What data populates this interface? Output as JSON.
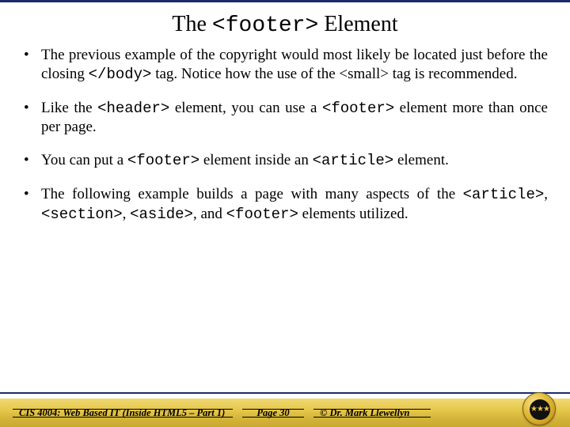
{
  "title": {
    "prefix": "The ",
    "code": "<footer>",
    "suffix": " Element"
  },
  "bullets": [
    {
      "segments": [
        {
          "t": "The previous example of the copyright would most likely be located just before the closing "
        },
        {
          "t": "</body>",
          "mono": true
        },
        {
          "t": "  tag.  Notice how the use of the <small> tag is recommended."
        }
      ]
    },
    {
      "segments": [
        {
          "t": "Like the "
        },
        {
          "t": "<header>",
          "mono": true
        },
        {
          "t": "  element, you can use a "
        },
        {
          "t": "<footer>",
          "mono": true
        },
        {
          "t": "  element more than once per page."
        }
      ]
    },
    {
      "segments": [
        {
          "t": "You can put a "
        },
        {
          "t": "<footer>",
          "mono": true
        },
        {
          "t": "  element inside an "
        },
        {
          "t": "<article>",
          "mono": true
        },
        {
          "t": "  element."
        }
      ]
    },
    {
      "segments": [
        {
          "t": "The following example builds a page with many aspects of the "
        },
        {
          "t": "<article>",
          "mono": true
        },
        {
          "t": ", "
        },
        {
          "t": "<section>",
          "mono": true
        },
        {
          "t": ", "
        },
        {
          "t": "<aside>",
          "mono": true
        },
        {
          "t": ", and "
        },
        {
          "t": "<footer>",
          "mono": true
        },
        {
          "t": "  elements utilized."
        }
      ]
    }
  ],
  "footer": {
    "course": "CIS 4004: Web Based IT (Inside HTML5 – Part 1)",
    "page": "Page 30",
    "author": "© Dr. Mark Llewellyn"
  }
}
